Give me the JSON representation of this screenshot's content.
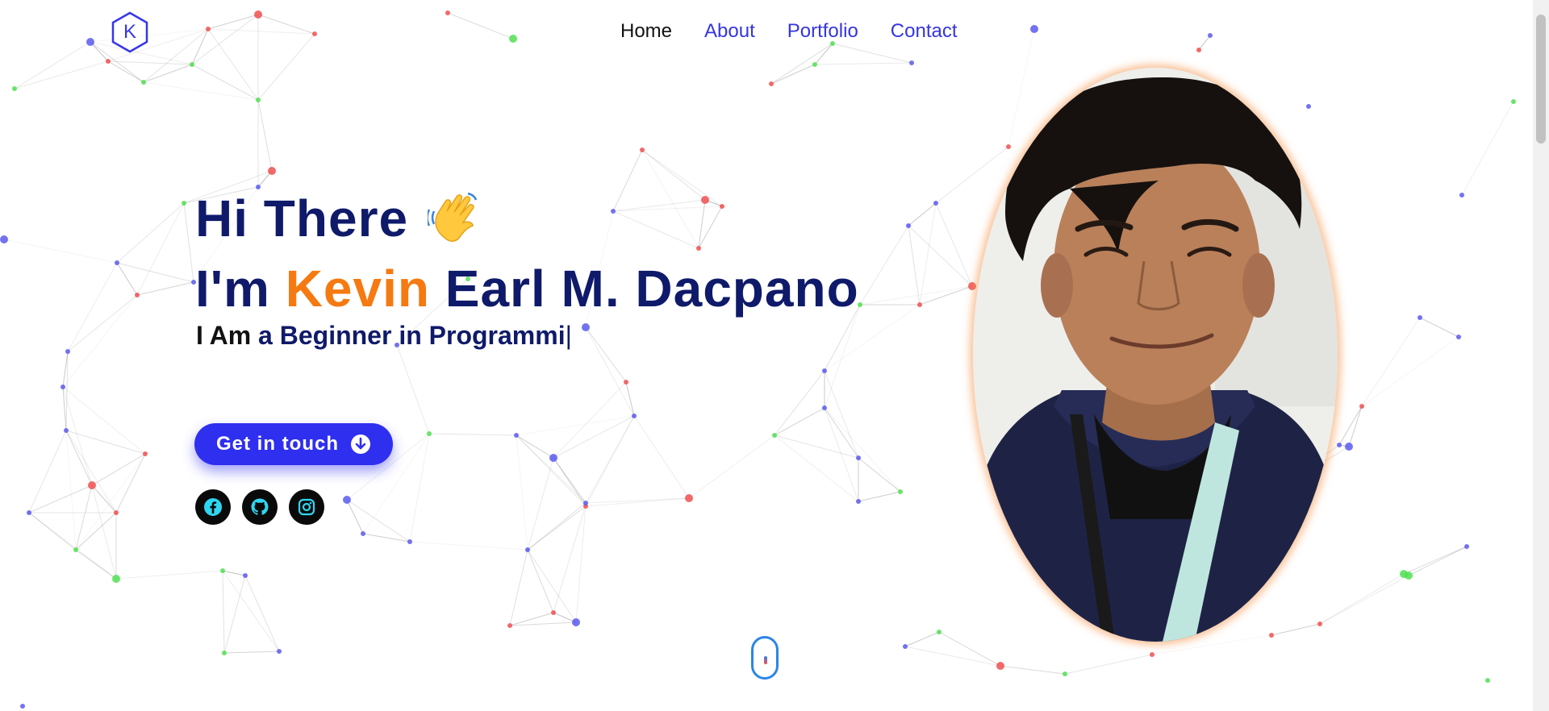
{
  "brand": {
    "logo_letter": "K",
    "accent": "#3737e8"
  },
  "nav": [
    {
      "label": "Home",
      "active": true
    },
    {
      "label": "About"
    },
    {
      "label": "Portfolio"
    },
    {
      "label": "Contact"
    }
  ],
  "hero": {
    "greeting": "Hi There",
    "wave_emoji": "👋",
    "intro_prefix": "I'm",
    "first_name": "Kevin",
    "rest_name": "Earl M. Dacpano",
    "subtitle_lead": "I Am",
    "subtitle_typed": "a Beginner in Programmi",
    "caret": "|",
    "cta_label": "Get in touch",
    "cta_icon": "arrow-down-circle-icon"
  },
  "socials": [
    {
      "name": "facebook",
      "icon": "facebook-icon"
    },
    {
      "name": "github",
      "icon": "github-icon"
    },
    {
      "name": "instagram",
      "icon": "instagram-icon"
    }
  ],
  "colors": {
    "title": "#0f1a6a",
    "highlight": "#f57a12",
    "cta": "#2f2ff0",
    "social_icon": "#2fd6f0",
    "photo_glow": "#f58c3c",
    "scroll_indicator": "#2a86e6"
  },
  "scroll_indicator": {
    "icon": "mouse-scroll-icon"
  }
}
